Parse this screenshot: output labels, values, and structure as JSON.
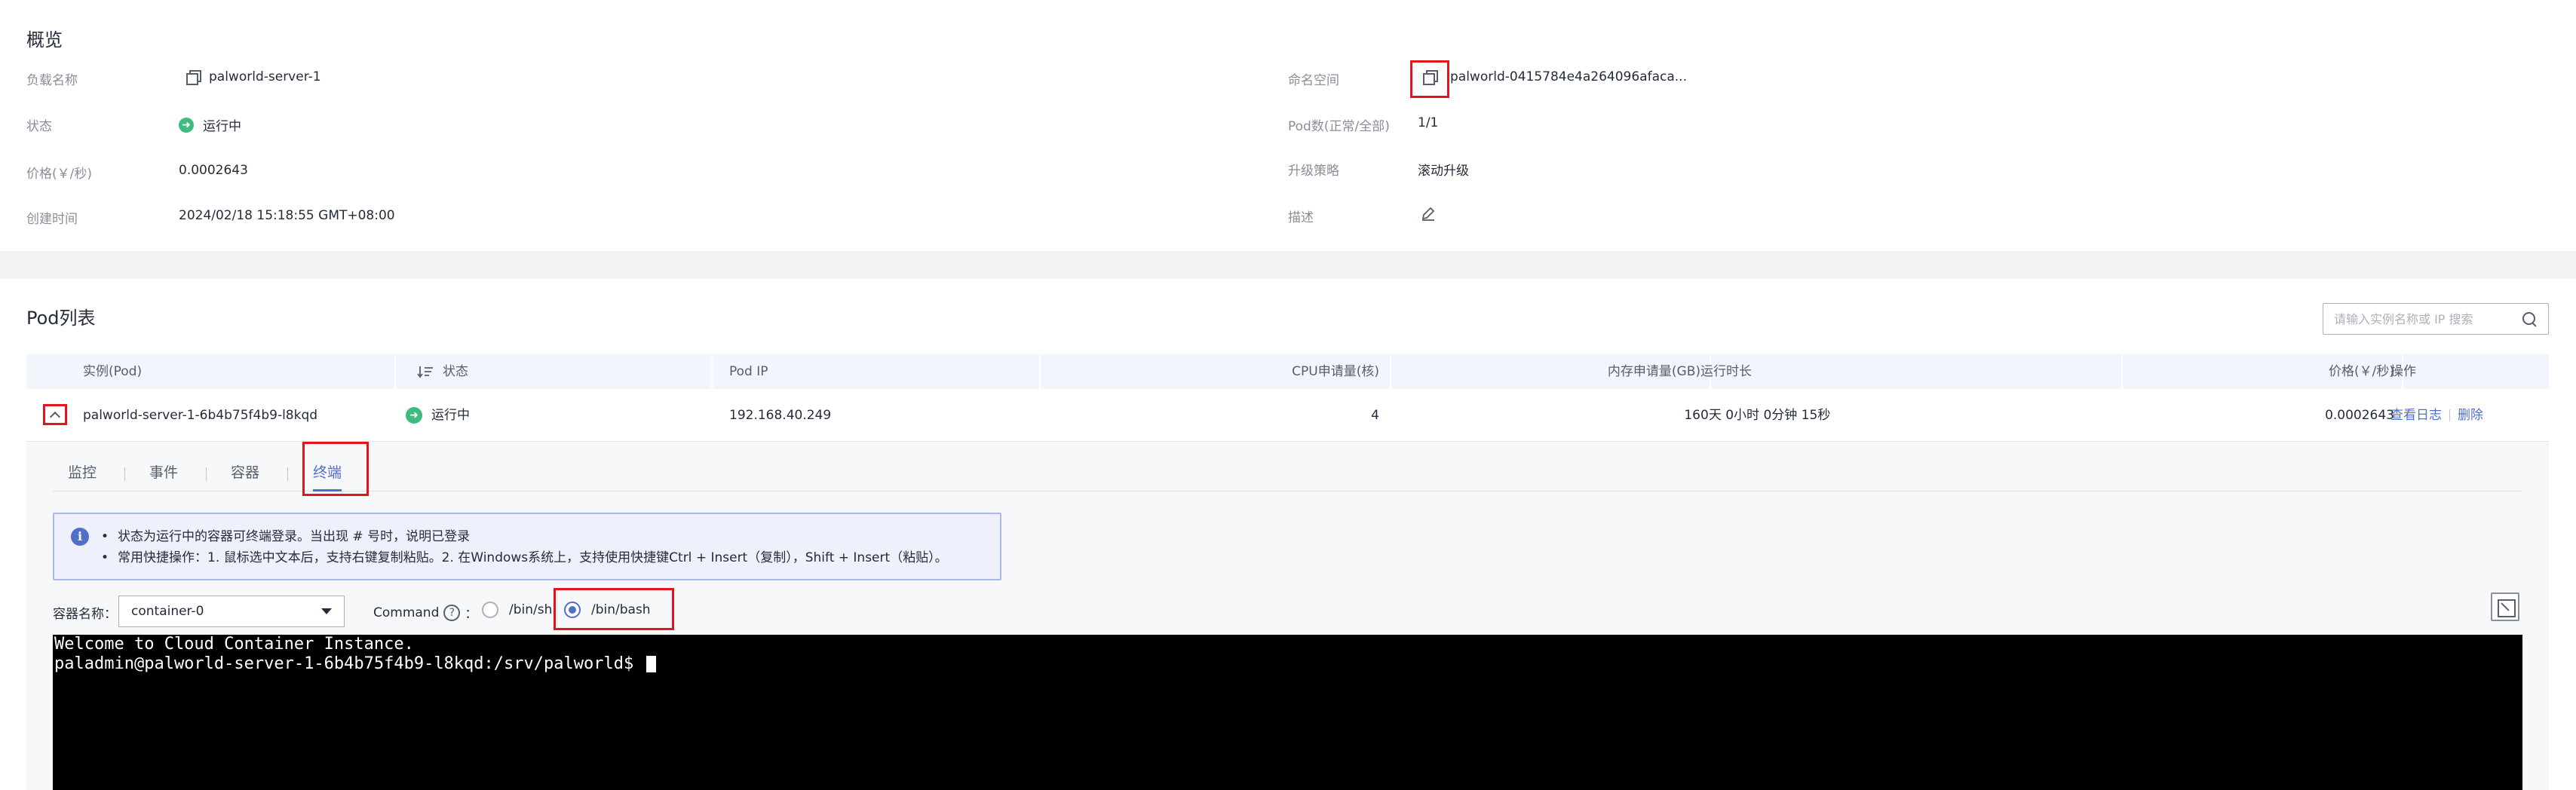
{
  "overview": {
    "title": "概览",
    "workload_label": "负载名称",
    "workload_value": "palworld-server-1",
    "status_label": "状态",
    "status_value": "运行中",
    "price_label": "价格(￥/秒)",
    "price_value": "0.0002643",
    "created_label": "创建时间",
    "created_value": "2024/02/18 15:18:55 GMT+08:00",
    "namespace_label": "命名空间",
    "namespace_value": "palworld-0415784e4a264096afaca...",
    "pods_label": "Pod数(正常/全部)",
    "pods_value": "1/1",
    "upgrade_label": "升级策略",
    "upgrade_value": "滚动升级",
    "desc_label": "描述"
  },
  "pod_list": {
    "title": "Pod列表",
    "search_placeholder": "请输入实例名称或 IP 搜索",
    "columns": {
      "instance": "实例(Pod)",
      "status": "状态",
      "pod_ip": "Pod IP",
      "cpu": "CPU申请量(核)",
      "memory": "内存申请量(GB)",
      "uptime": "运行时长",
      "price": "价格(￥/秒)",
      "actions": "操作"
    },
    "rows": [
      {
        "instance": "palworld-server-1-6b4b75f4b9-l8kqd",
        "status": "运行中",
        "pod_ip": "192.168.40.249",
        "cpu": "4",
        "memory": "16",
        "uptime": "0天 0小时 0分钟 15秒",
        "price": "0.0002643",
        "action_logs": "查看日志",
        "action_delete": "删除"
      }
    ]
  },
  "detail": {
    "tabs": [
      "监控",
      "事件",
      "容器",
      "终端"
    ],
    "active_tab": "终端",
    "info_lines": [
      "状态为运行中的容器可终端登录。当出现 # 号时，说明已登录",
      "常用快捷操作：1. 鼠标选中文本后，支持右键复制粘贴。2. 在Windows系统上，支持使用快捷键Ctrl + Insert（复制），Shift + Insert（粘贴）。"
    ],
    "container_label": "容器名称：",
    "container_value": "container-0",
    "command_label": "Command",
    "command_help": "?",
    "command_colon": "：",
    "cmd_sh": "/bin/sh",
    "cmd_bash": "/bin/bash",
    "selected_command": "/bin/bash"
  },
  "terminal": {
    "line1": "Welcome to Cloud Container Instance.",
    "line2": "paladmin@palworld-server-1-6b4b75f4b9-l8kqd:/srv/palworld$ "
  },
  "colors": {
    "accent": "#526ecc",
    "running": "#3ebc7d",
    "highlight": "#e2141c",
    "terminal_bg": "#000000"
  }
}
